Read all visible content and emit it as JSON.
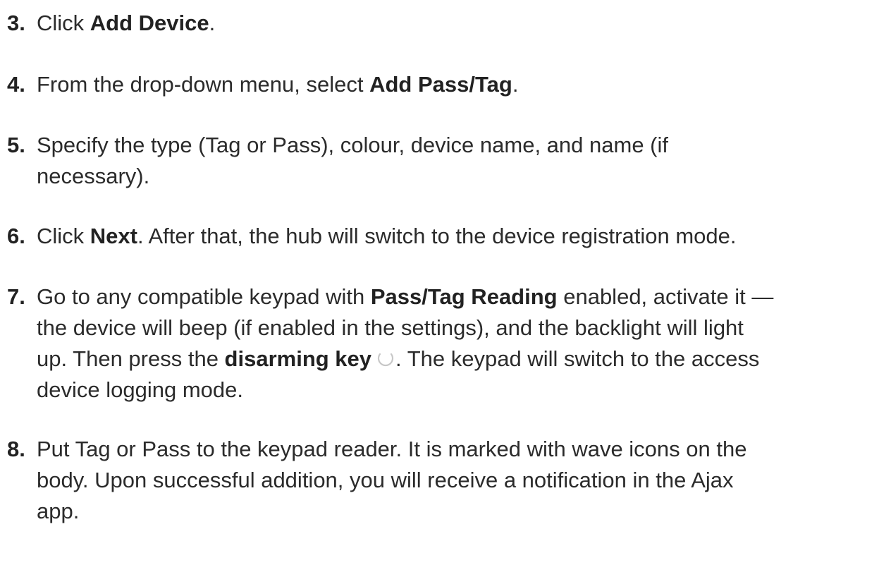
{
  "steps": [
    {
      "number": "3.",
      "parts": {
        "a": "Click ",
        "b": "Add Device",
        "c": "."
      }
    },
    {
      "number": "4.",
      "parts": {
        "a": "From the drop-down menu, select ",
        "b": "Add Pass/Tag",
        "c": "."
      }
    },
    {
      "number": "5.",
      "lines": [
        "Specify the type (Tag or Pass), colour, device name, and name (if",
        "necessary)."
      ]
    },
    {
      "number": "6.",
      "parts": {
        "a": "Click ",
        "b": "Next",
        "c": ". After that, the hub will switch to the device registration mode."
      }
    },
    {
      "number": "7.",
      "parts": {
        "a": "Go to any compatible keypad with ",
        "b": "Pass/Tag Reading",
        "c": " enabled, activate it —",
        "line2": "the device will beep (if enabled in the settings), and the backlight will light",
        "line3a": "up. Then press the ",
        "line3b": "disarming key",
        "line3c": ". The keypad will switch to the access",
        "line4": "device logging mode."
      },
      "icon": "disarm-circle-icon"
    },
    {
      "number": "8.",
      "lines": [
        "Put Tag or Pass to the keypad reader. It is marked with wave icons on the",
        "body. Upon successful addition, you will receive a notification in the Ajax",
        "app."
      ]
    }
  ]
}
